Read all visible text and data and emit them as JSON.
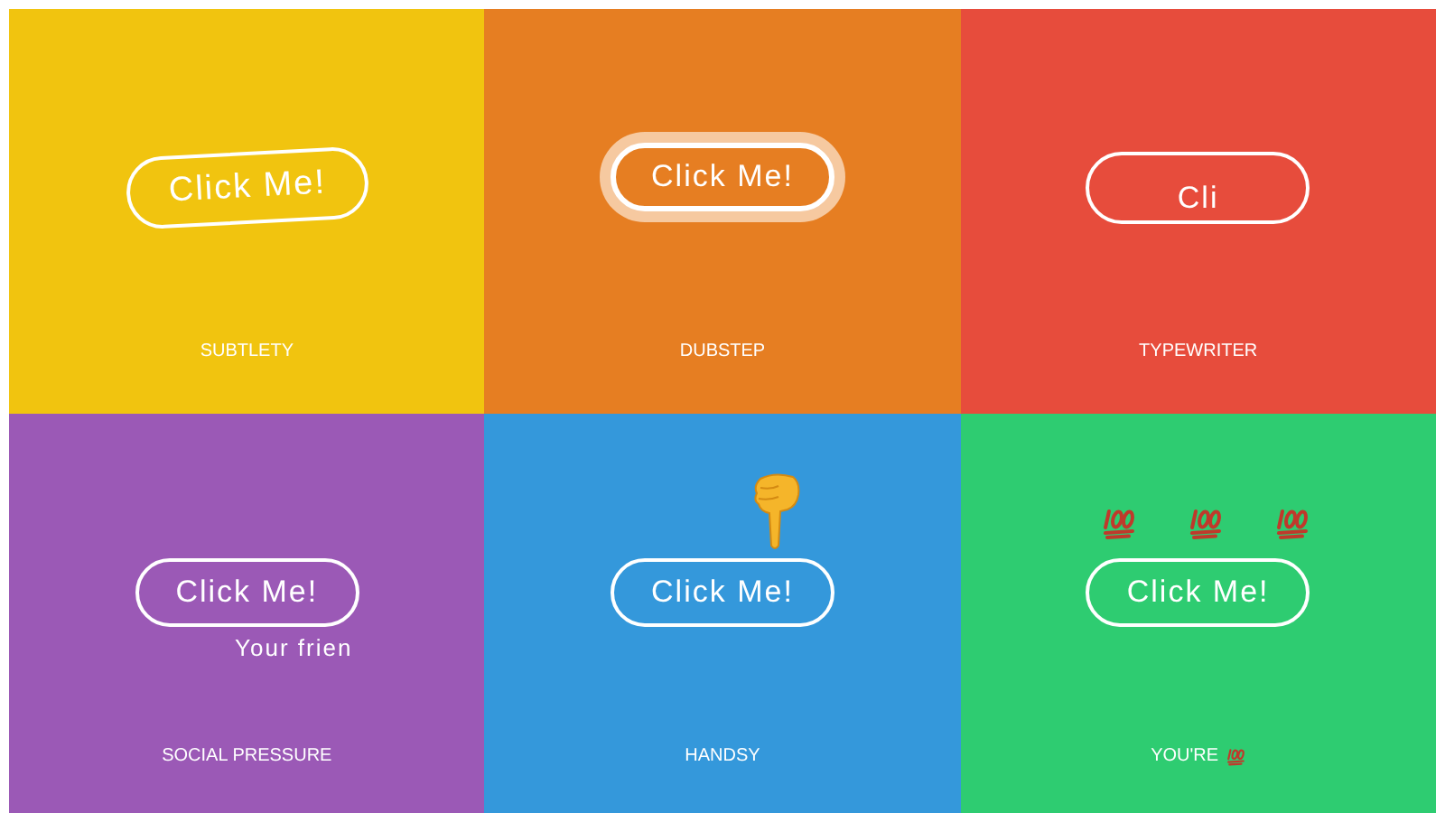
{
  "cells": [
    {
      "kind": "subtlety",
      "color": "#f1c40f",
      "button": "Click Me!",
      "label": "SUBTLETY"
    },
    {
      "kind": "dubstep",
      "color": "#e67e22",
      "button": "Click Me!",
      "label": "DUBSTEP"
    },
    {
      "kind": "typewriter",
      "color": "#e74c3c",
      "button": "Cli",
      "label": "TYPEWRITER"
    },
    {
      "kind": "social",
      "color": "#9b59b6",
      "button": "Click Me!",
      "caption": "Your frien",
      "label": "SOCIAL PRESSURE"
    },
    {
      "kind": "handsy",
      "color": "#3498db",
      "button": "Click Me!",
      "label": "HANDSY"
    },
    {
      "kind": "hundred",
      "color": "#2ecc71",
      "button": "Click Me!",
      "label": "YOU'RE"
    }
  ]
}
